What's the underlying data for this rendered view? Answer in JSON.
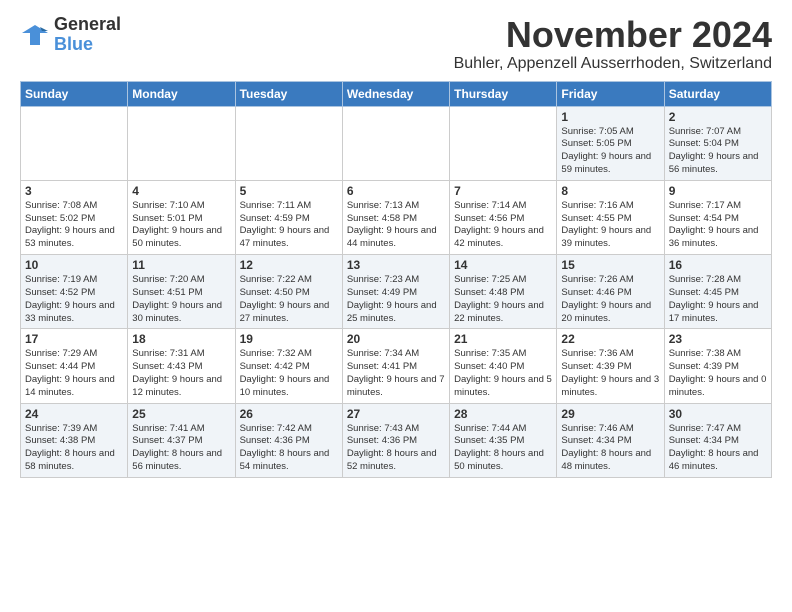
{
  "logo": {
    "line1": "General",
    "line2": "Blue"
  },
  "title": "November 2024",
  "location": "Buhler, Appenzell Ausserrhoden, Switzerland",
  "weekdays": [
    "Sunday",
    "Monday",
    "Tuesday",
    "Wednesday",
    "Thursday",
    "Friday",
    "Saturday"
  ],
  "weeks": [
    [
      {
        "day": "",
        "sunrise": "",
        "sunset": "",
        "daylight": ""
      },
      {
        "day": "",
        "sunrise": "",
        "sunset": "",
        "daylight": ""
      },
      {
        "day": "",
        "sunrise": "",
        "sunset": "",
        "daylight": ""
      },
      {
        "day": "",
        "sunrise": "",
        "sunset": "",
        "daylight": ""
      },
      {
        "day": "",
        "sunrise": "",
        "sunset": "",
        "daylight": ""
      },
      {
        "day": "1",
        "sunrise": "Sunrise: 7:05 AM",
        "sunset": "Sunset: 5:05 PM",
        "daylight": "Daylight: 9 hours and 59 minutes."
      },
      {
        "day": "2",
        "sunrise": "Sunrise: 7:07 AM",
        "sunset": "Sunset: 5:04 PM",
        "daylight": "Daylight: 9 hours and 56 minutes."
      }
    ],
    [
      {
        "day": "3",
        "sunrise": "Sunrise: 7:08 AM",
        "sunset": "Sunset: 5:02 PM",
        "daylight": "Daylight: 9 hours and 53 minutes."
      },
      {
        "day": "4",
        "sunrise": "Sunrise: 7:10 AM",
        "sunset": "Sunset: 5:01 PM",
        "daylight": "Daylight: 9 hours and 50 minutes."
      },
      {
        "day": "5",
        "sunrise": "Sunrise: 7:11 AM",
        "sunset": "Sunset: 4:59 PM",
        "daylight": "Daylight: 9 hours and 47 minutes."
      },
      {
        "day": "6",
        "sunrise": "Sunrise: 7:13 AM",
        "sunset": "Sunset: 4:58 PM",
        "daylight": "Daylight: 9 hours and 44 minutes."
      },
      {
        "day": "7",
        "sunrise": "Sunrise: 7:14 AM",
        "sunset": "Sunset: 4:56 PM",
        "daylight": "Daylight: 9 hours and 42 minutes."
      },
      {
        "day": "8",
        "sunrise": "Sunrise: 7:16 AM",
        "sunset": "Sunset: 4:55 PM",
        "daylight": "Daylight: 9 hours and 39 minutes."
      },
      {
        "day": "9",
        "sunrise": "Sunrise: 7:17 AM",
        "sunset": "Sunset: 4:54 PM",
        "daylight": "Daylight: 9 hours and 36 minutes."
      }
    ],
    [
      {
        "day": "10",
        "sunrise": "Sunrise: 7:19 AM",
        "sunset": "Sunset: 4:52 PM",
        "daylight": "Daylight: 9 hours and 33 minutes."
      },
      {
        "day": "11",
        "sunrise": "Sunrise: 7:20 AM",
        "sunset": "Sunset: 4:51 PM",
        "daylight": "Daylight: 9 hours and 30 minutes."
      },
      {
        "day": "12",
        "sunrise": "Sunrise: 7:22 AM",
        "sunset": "Sunset: 4:50 PM",
        "daylight": "Daylight: 9 hours and 27 minutes."
      },
      {
        "day": "13",
        "sunrise": "Sunrise: 7:23 AM",
        "sunset": "Sunset: 4:49 PM",
        "daylight": "Daylight: 9 hours and 25 minutes."
      },
      {
        "day": "14",
        "sunrise": "Sunrise: 7:25 AM",
        "sunset": "Sunset: 4:48 PM",
        "daylight": "Daylight: 9 hours and 22 minutes."
      },
      {
        "day": "15",
        "sunrise": "Sunrise: 7:26 AM",
        "sunset": "Sunset: 4:46 PM",
        "daylight": "Daylight: 9 hours and 20 minutes."
      },
      {
        "day": "16",
        "sunrise": "Sunrise: 7:28 AM",
        "sunset": "Sunset: 4:45 PM",
        "daylight": "Daylight: 9 hours and 17 minutes."
      }
    ],
    [
      {
        "day": "17",
        "sunrise": "Sunrise: 7:29 AM",
        "sunset": "Sunset: 4:44 PM",
        "daylight": "Daylight: 9 hours and 14 minutes."
      },
      {
        "day": "18",
        "sunrise": "Sunrise: 7:31 AM",
        "sunset": "Sunset: 4:43 PM",
        "daylight": "Daylight: 9 hours and 12 minutes."
      },
      {
        "day": "19",
        "sunrise": "Sunrise: 7:32 AM",
        "sunset": "Sunset: 4:42 PM",
        "daylight": "Daylight: 9 hours and 10 minutes."
      },
      {
        "day": "20",
        "sunrise": "Sunrise: 7:34 AM",
        "sunset": "Sunset: 4:41 PM",
        "daylight": "Daylight: 9 hours and 7 minutes."
      },
      {
        "day": "21",
        "sunrise": "Sunrise: 7:35 AM",
        "sunset": "Sunset: 4:40 PM",
        "daylight": "Daylight: 9 hours and 5 minutes."
      },
      {
        "day": "22",
        "sunrise": "Sunrise: 7:36 AM",
        "sunset": "Sunset: 4:39 PM",
        "daylight": "Daylight: 9 hours and 3 minutes."
      },
      {
        "day": "23",
        "sunrise": "Sunrise: 7:38 AM",
        "sunset": "Sunset: 4:39 PM",
        "daylight": "Daylight: 9 hours and 0 minutes."
      }
    ],
    [
      {
        "day": "24",
        "sunrise": "Sunrise: 7:39 AM",
        "sunset": "Sunset: 4:38 PM",
        "daylight": "Daylight: 8 hours and 58 minutes."
      },
      {
        "day": "25",
        "sunrise": "Sunrise: 7:41 AM",
        "sunset": "Sunset: 4:37 PM",
        "daylight": "Daylight: 8 hours and 56 minutes."
      },
      {
        "day": "26",
        "sunrise": "Sunrise: 7:42 AM",
        "sunset": "Sunset: 4:36 PM",
        "daylight": "Daylight: 8 hours and 54 minutes."
      },
      {
        "day": "27",
        "sunrise": "Sunrise: 7:43 AM",
        "sunset": "Sunset: 4:36 PM",
        "daylight": "Daylight: 8 hours and 52 minutes."
      },
      {
        "day": "28",
        "sunrise": "Sunrise: 7:44 AM",
        "sunset": "Sunset: 4:35 PM",
        "daylight": "Daylight: 8 hours and 50 minutes."
      },
      {
        "day": "29",
        "sunrise": "Sunrise: 7:46 AM",
        "sunset": "Sunset: 4:34 PM",
        "daylight": "Daylight: 8 hours and 48 minutes."
      },
      {
        "day": "30",
        "sunrise": "Sunrise: 7:47 AM",
        "sunset": "Sunset: 4:34 PM",
        "daylight": "Daylight: 8 hours and 46 minutes."
      }
    ]
  ]
}
